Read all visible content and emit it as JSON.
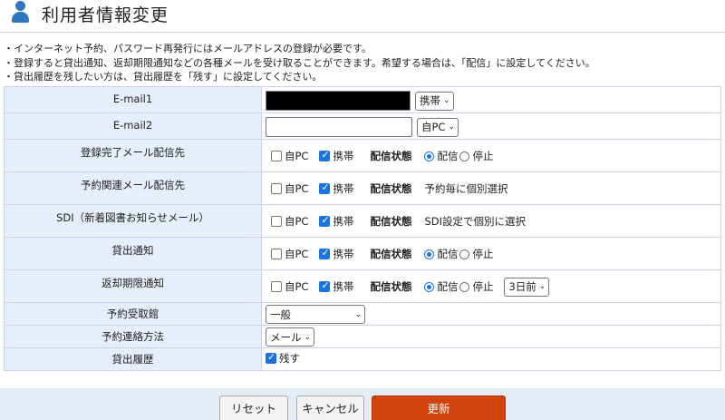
{
  "header": {
    "title": "利用者情報変更",
    "icon": "user-icon"
  },
  "notes": [
    "・インターネット予約、パスワード再発行にはメールアドレスの登録が必要です。",
    "・登録すると貸出通知、返却期限通知などの各種メールを受け取ることができます。希望する場合は、「配信」に設定してください。",
    "・貸出履歴を残したい方は、貸出履歴を「残す」に設定してください。"
  ],
  "form": {
    "email1": {
      "label": "E-mail1",
      "value": "",
      "masked": true,
      "type": "携帯"
    },
    "email2": {
      "label": "E-mail2",
      "value": "",
      "type": "自PC"
    },
    "common": {
      "pc": "自PC",
      "mobile": "携帯",
      "status_label": "配信状態",
      "deliver": "配信",
      "stop": "停止"
    },
    "rows": [
      {
        "label": "登録完了メール配信先",
        "pc": false,
        "mobile": true,
        "status": "配信"
      },
      {
        "label": "予約関連メール配信先",
        "pc": false,
        "mobile": true,
        "status_text": "予約毎に個別選択"
      },
      {
        "label": "SDI（新着図書お知らせメール）",
        "pc": false,
        "mobile": true,
        "status_text": "SDI設定で個別に選択"
      },
      {
        "label": "貸出通知",
        "pc": false,
        "mobile": true,
        "status": "配信"
      },
      {
        "label": "返却期限通知",
        "pc": false,
        "mobile": true,
        "status": "配信",
        "days": "3日前"
      }
    ],
    "pickup": {
      "label": "予約受取館",
      "value": "一般"
    },
    "contact": {
      "label": "予約連絡方法",
      "value": "メール"
    },
    "history": {
      "label": "貸出履歴",
      "option": "残す",
      "checked": true
    }
  },
  "buttons": {
    "reset": "リセット",
    "cancel": "キャンセル",
    "update": "更新"
  }
}
